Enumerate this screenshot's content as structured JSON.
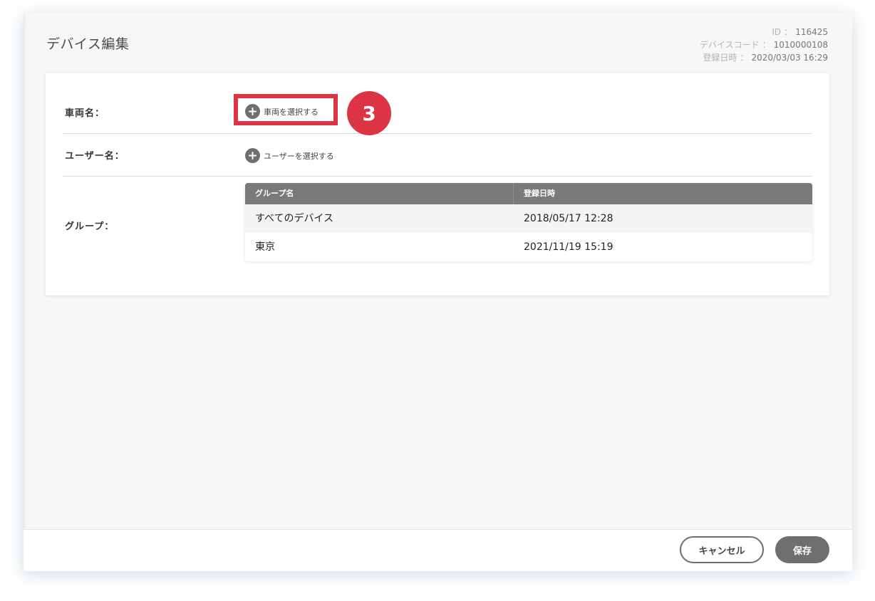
{
  "header": {
    "title": "デバイス編集",
    "meta": [
      {
        "label": "ID",
        "sep": "：",
        "value": "116425"
      },
      {
        "label": "デバイスコード",
        "sep": "：",
        "value": "1010000108"
      },
      {
        "label": "登録日時",
        "sep": "：",
        "value": "2020/03/03 16:29"
      }
    ]
  },
  "form": {
    "vehicle": {
      "label": "車両名：",
      "button": "車両を選択する"
    },
    "user": {
      "label": "ユーザー名：",
      "button": "ユーザーを選択する"
    },
    "group": {
      "label": "グループ：",
      "columns": [
        "グループ名",
        "登録日時"
      ],
      "rows": [
        [
          "すべてのデバイス",
          "2018/05/17 12:28"
        ],
        [
          "東京",
          "2021/11/19 15:19"
        ]
      ]
    }
  },
  "annotation": {
    "step": "3",
    "color": "#dc3345"
  },
  "footer": {
    "cancel": "キャンセル",
    "save": "保存"
  },
  "icons": {
    "add": "plus-circle-icon"
  }
}
